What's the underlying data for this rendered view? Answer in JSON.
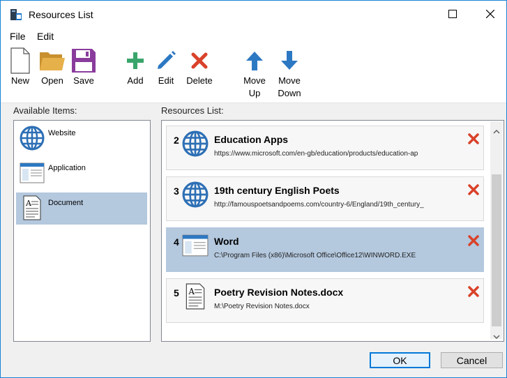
{
  "window": {
    "title": "Resources List"
  },
  "menu": {
    "file": "File",
    "edit": "Edit"
  },
  "toolbar": {
    "new": "New",
    "open": "Open",
    "save": "Save",
    "add": "Add",
    "edit": "Edit",
    "delete": "Delete",
    "move_up_1": "Move",
    "move_up_2": "Up",
    "move_down_1": "Move",
    "move_down_2": "Down"
  },
  "available": {
    "label": "Available Items:",
    "items": [
      {
        "label": "Website",
        "icon": "globe-icon"
      },
      {
        "label": "Application",
        "icon": "application-window-icon"
      },
      {
        "label": "Document",
        "icon": "document-icon",
        "selected": true
      }
    ]
  },
  "resources": {
    "label": "Resources List:",
    "items": [
      {
        "num": "2",
        "title": "Education Apps",
        "path": "https://www.microsoft.com/en-gb/education/products/education-ap",
        "icon": "globe-icon"
      },
      {
        "num": "3",
        "title": "19th century English Poets",
        "path": "http://famouspoetsandpoems.com/country-6/England/19th_century_",
        "icon": "globe-icon"
      },
      {
        "num": "4",
        "title": "Word",
        "path": "C:\\Program Files (x86)\\Microsoft Office\\Office12\\WINWORD.EXE",
        "icon": "application-window-icon",
        "selected": true
      },
      {
        "num": "5",
        "title": "Poetry Revision Notes.docx",
        "path": "M:\\Poetry Revision Notes.docx",
        "icon": "document-icon"
      }
    ]
  },
  "buttons": {
    "ok": "OK",
    "cancel": "Cancel"
  },
  "colors": {
    "accent": "#1883d7",
    "selection": "#b4c8de",
    "delete_red": "#d9422a",
    "add_green": "#3aa56b",
    "arrow_blue": "#2d78c3",
    "save_purple": "#8a3c9c",
    "folder_yellow": "#e6b04a"
  }
}
